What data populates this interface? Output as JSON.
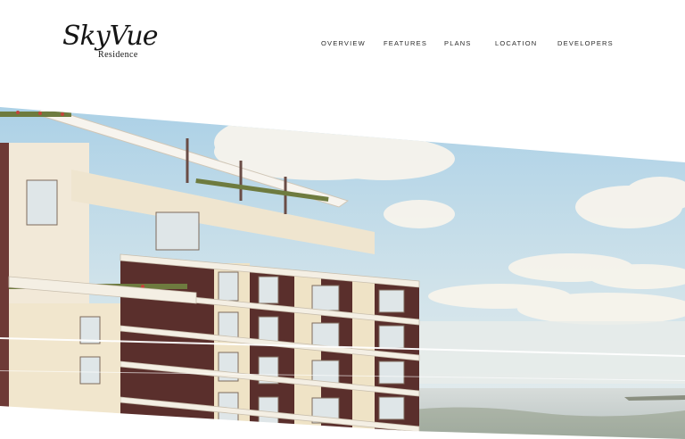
{
  "brand": {
    "logo_main": "SkyVue",
    "logo_sub": "Residence"
  },
  "nav": {
    "items": [
      "OVERVIEW",
      "FEATURES",
      "PLANS",
      "LOCATION",
      "DEVELOPERS"
    ]
  },
  "hero": {
    "image": "building-render-image",
    "colors": {
      "sky_top": "#a8cfe6",
      "sky_bottom": "#e7efef",
      "cloud": "#f6f3ea",
      "facade_brown": "#5b2f2d",
      "facade_cream": "#efe3c6",
      "balcony_white": "#f4efe4",
      "sea": "#c8d0cf"
    }
  }
}
